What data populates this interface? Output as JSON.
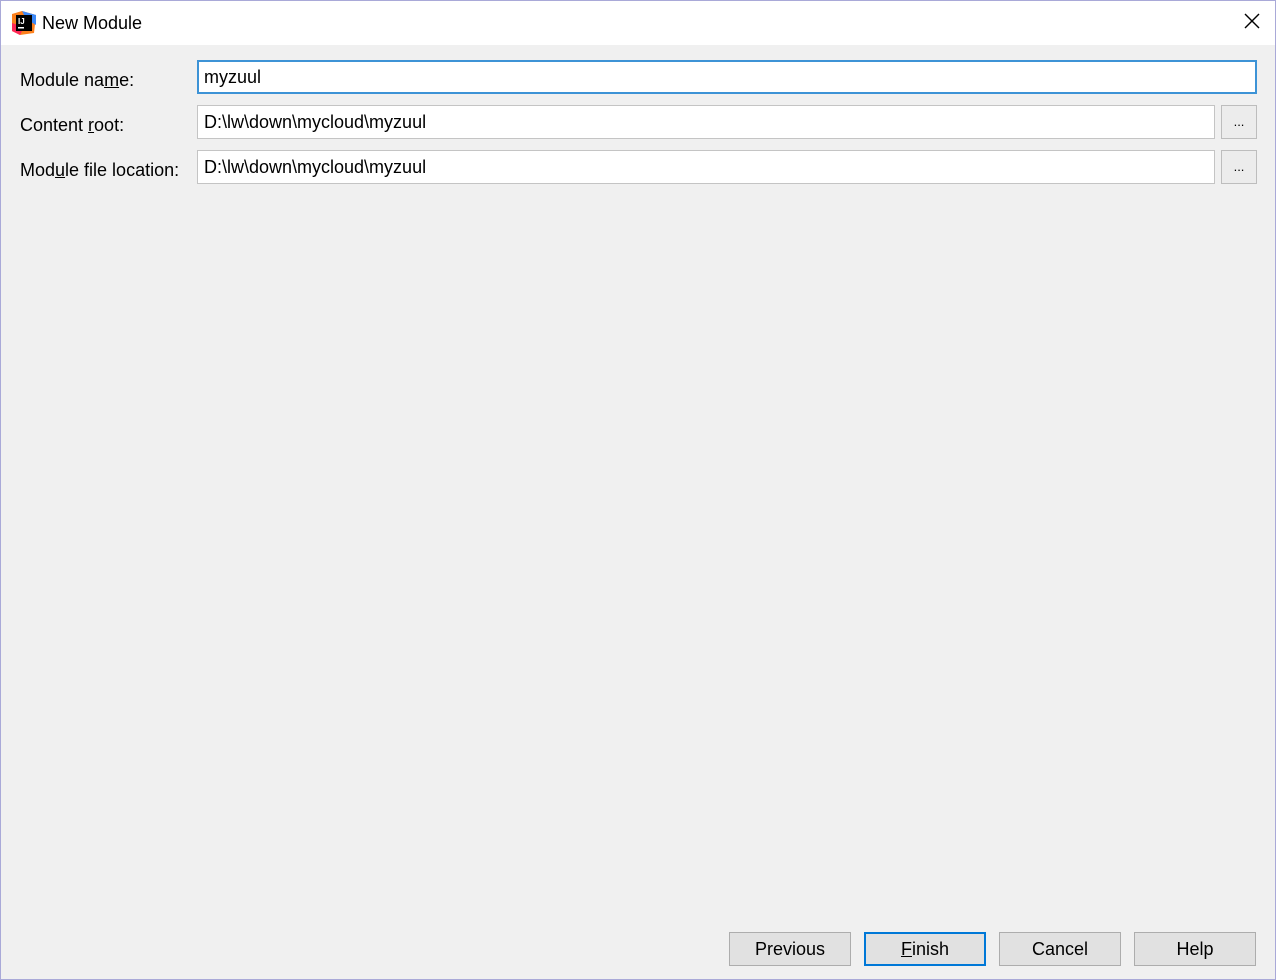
{
  "window": {
    "title": "New Module",
    "app_icon": "intellij-idea-icon",
    "close_icon": "close-icon"
  },
  "form": {
    "module_name": {
      "label_parts": [
        "Module na",
        "m",
        "e:"
      ],
      "value": "myzuul"
    },
    "content_root": {
      "label_parts": [
        "Content ",
        "r",
        "oot:"
      ],
      "value": "D:\\lw\\down\\mycloud\\myzuul",
      "browse_label": "..."
    },
    "module_file_location": {
      "label_parts": [
        "Mod",
        "u",
        "le file location:"
      ],
      "value": "D:\\lw\\down\\mycloud\\myzuul",
      "browse_label": "..."
    }
  },
  "buttons": {
    "previous": "Previous",
    "finish_parts": [
      "F",
      "inish"
    ],
    "cancel": "Cancel",
    "help": "Help"
  },
  "colors": {
    "focus_border": "#3d93d6",
    "default_button_border": "#0078d7",
    "dialog_background": "#f0f0f0"
  }
}
